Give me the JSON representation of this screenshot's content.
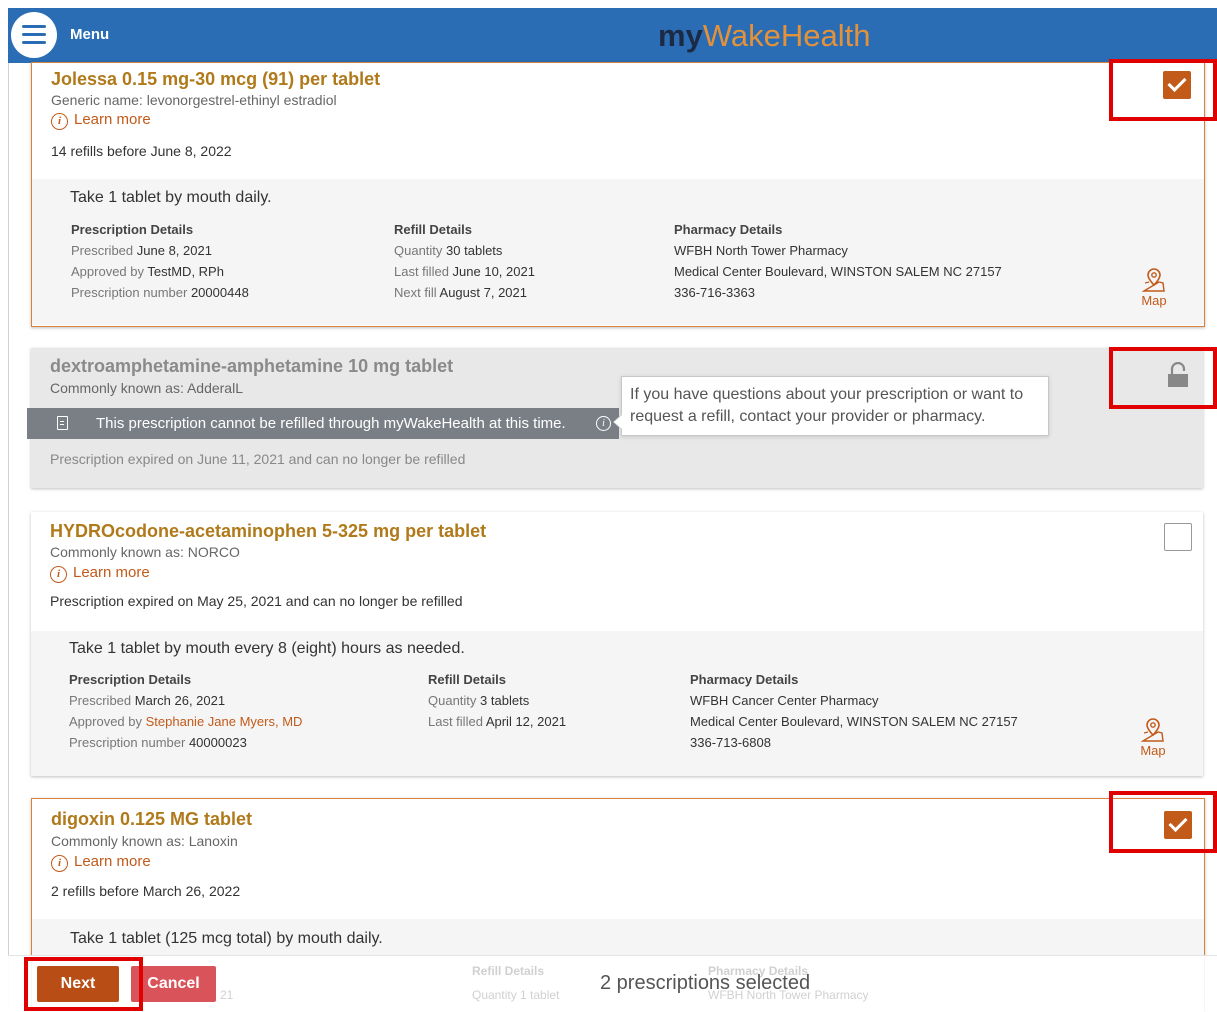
{
  "header": {
    "menu_label": "Menu",
    "brand_my": "my",
    "brand_rest": "WakeHealth"
  },
  "medications": [
    {
      "name": "Jolessa 0.15 mg-30 mcg (91) per tablet",
      "subtitle": "Generic name: levonorgestrel-ethinyl estradiol",
      "learn_more": "Learn more",
      "status": "14 refills before June 8, 2022",
      "sig": "Take 1 tablet by mouth daily.",
      "prescription": {
        "header": "Prescription Details",
        "prescribed_label": "Prescribed",
        "prescribed": "June 8, 2021",
        "approved_label": "Approved by",
        "approved": "TestMD, RPh",
        "number_label": "Prescription number",
        "number": "20000448"
      },
      "refill": {
        "header": "Refill Details",
        "quantity_label": "Quantity",
        "quantity": "30 tablets",
        "last_label": "Last filled",
        "last": "June 10, 2021",
        "next_label": "Next fill",
        "next": "August 7, 2021"
      },
      "pharmacy": {
        "header": "Pharmacy Details",
        "name": "WFBH North Tower Pharmacy",
        "address": "Medical Center Boulevard, WINSTON SALEM NC 27157",
        "phone": "336-716-3363"
      },
      "map_label": "Map",
      "selected": true
    },
    {
      "name": "dextroamphetamine-amphetamine 10 mg tablet",
      "subtitle": "Commonly known as: AdderalL",
      "banner": "This prescription cannot be refilled through myWakeHealth at this time.",
      "tooltip": "If you have questions about your prescription or want to request a refill, contact your provider or pharmacy.",
      "status": "Prescription expired on June 11, 2021 and can no longer be refilled",
      "locked": true
    },
    {
      "name": "HYDROcodone-acetaminophen 5-325 mg per tablet",
      "subtitle": "Commonly known as: NORCO",
      "learn_more": "Learn more",
      "status": "Prescription expired on May 25, 2021 and can no longer be refilled",
      "sig": "Take 1 tablet by mouth every 8 (eight) hours as needed.",
      "prescription": {
        "header": "Prescription Details",
        "prescribed_label": "Prescribed",
        "prescribed": "March 26, 2021",
        "approved_label": "Approved by",
        "approved": "Stephanie Jane Myers, MD",
        "number_label": "Prescription number",
        "number": "40000023"
      },
      "refill": {
        "header": "Refill Details",
        "quantity_label": "Quantity",
        "quantity": "3 tablets",
        "last_label": "Last filled",
        "last": "April 12, 2021"
      },
      "pharmacy": {
        "header": "Pharmacy Details",
        "name": "WFBH Cancer Center Pharmacy",
        "address": "Medical Center Boulevard, WINSTON SALEM NC 27157",
        "phone": "336-713-6808"
      },
      "map_label": "Map",
      "selected": false
    },
    {
      "name": "digoxin 0.125 MG tablet",
      "subtitle": "Commonly known as: Lanoxin",
      "learn_more": "Learn more",
      "status": "2 refills before March 26, 2022",
      "sig": "Take 1 tablet (125 mcg total) by mouth daily.",
      "ghost": {
        "refill_header": "Refill Details",
        "pharmacy_header": "Pharmacy Details",
        "quantity": "Quantity 1 tablet",
        "pharmacy": "WFBH North Tower Pharmacy",
        "date_fragment": "21"
      },
      "selected": true
    }
  ],
  "footer": {
    "next_label": "Next",
    "cancel_label": "Cancel",
    "selection_text": "2 prescriptions selected"
  },
  "colors": {
    "header_bg": "#2b6db5",
    "accent": "#c25a1a",
    "highlight": "#e00000",
    "brand_orange": "#e3923a",
    "brand_navy": "#1d2a44"
  }
}
